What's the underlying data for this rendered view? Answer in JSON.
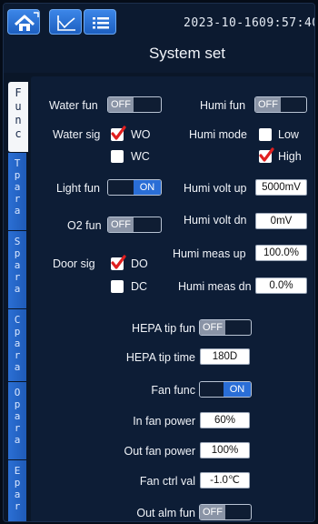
{
  "header": {
    "date": "2023-10-16",
    "time": "09:57:40",
    "title": "System set",
    "icons": [
      "home-icon",
      "chart-icon",
      "list-icon"
    ]
  },
  "tabs": [
    {
      "id": "func",
      "letters": [
        "F",
        "u",
        "n",
        "c"
      ],
      "active": true
    },
    {
      "id": "tpara",
      "letters": [
        "T",
        "p",
        "a",
        "r",
        "a"
      ],
      "active": false
    },
    {
      "id": "spara",
      "letters": [
        "S",
        "p",
        "a",
        "r",
        "a"
      ],
      "active": false
    },
    {
      "id": "cpara",
      "letters": [
        "C",
        "p",
        "a",
        "r",
        "a"
      ],
      "active": false
    },
    {
      "id": "opara",
      "letters": [
        "O",
        "p",
        "a",
        "r",
        "a"
      ],
      "active": false
    },
    {
      "id": "epara",
      "letters": [
        "E",
        "p",
        "a",
        "r"
      ],
      "active": false
    }
  ],
  "left": {
    "water_fun": {
      "label": "Water fun",
      "state": "OFF"
    },
    "water_sig": {
      "label": "Water sig",
      "opt1": "WO",
      "opt1_checked": true,
      "opt2": "WC",
      "opt2_checked": false
    },
    "light_fun": {
      "label": "Light fun",
      "state": "ON"
    },
    "o2_fun": {
      "label": "O2 fun",
      "state": "OFF"
    },
    "door_sig": {
      "label": "Door sig",
      "opt1": "DO",
      "opt1_checked": true,
      "opt2": "DC",
      "opt2_checked": false
    }
  },
  "right": {
    "humi_fun": {
      "label": "Humi fun",
      "state": "OFF"
    },
    "humi_mode": {
      "label": "Humi mode",
      "opt1": "Low",
      "opt1_checked": false,
      "opt2": "High",
      "opt2_checked": true
    },
    "humi_volt_up": {
      "label": "Humi volt up",
      "value": "5000mV"
    },
    "humi_volt_dn": {
      "label": "Humi volt dn",
      "value": "0mV"
    },
    "humi_meas_up": {
      "label": "Humi meas up",
      "value": "100.0%"
    },
    "humi_meas_dn": {
      "label": "Humi meas dn",
      "value": "0.0%"
    }
  },
  "bottom": {
    "hepa_tip_fun": {
      "label": "HEPA tip fun",
      "state": "OFF"
    },
    "hepa_tip_time": {
      "label": "HEPA tip time",
      "value": "180D"
    },
    "fan_func": {
      "label": "Fan func",
      "state": "ON"
    },
    "in_fan_power": {
      "label": "In fan power",
      "value": "60%"
    },
    "out_fan_power": {
      "label": "Out fan power",
      "value": "100%"
    },
    "fan_ctrl_val": {
      "label": "Fan ctrl val",
      "value": "-1.0℃"
    },
    "out_alm_fun": {
      "label": "Out alm fun",
      "state": "OFF"
    }
  },
  "colors": {
    "accent": "#2a6ed6",
    "check": "#e02020",
    "background": "#0a1628"
  }
}
